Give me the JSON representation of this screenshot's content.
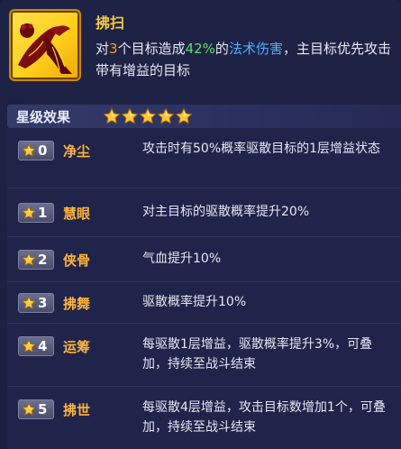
{
  "skill": {
    "name": "拂扫",
    "desc_parts": {
      "p1": "对",
      "targets": "3",
      "p2": "个目标造成",
      "percent": "42%",
      "p3": "的",
      "dmg_type": "法术伤害",
      "p4": "，主目标优先攻击带有增益的目标"
    }
  },
  "star_section": {
    "title": "星级效果",
    "star_count": 5
  },
  "rows": [
    {
      "level": "0",
      "name": "净尘",
      "text": "攻击时有50%概率驱散目标的1层增益状态"
    },
    {
      "level": "1",
      "name": "慧眼",
      "text": "对主目标的驱散概率提升20%"
    },
    {
      "level": "2",
      "name": "侠骨",
      "text": "气血提升10%"
    },
    {
      "level": "3",
      "name": "拂舞",
      "text": "驱散概率提升10%"
    },
    {
      "level": "4",
      "name": "运筹",
      "text": "每驱散1层增益，驱散概率提升3%，可叠加，持续至战斗结束"
    },
    {
      "level": "5",
      "name": "拂世",
      "text": "每驱散4层增益，攻击目标数增加1个，可叠加，持续至战斗结束"
    }
  ],
  "colors": {
    "accent_gold": "#f1c84a",
    "name_orange": "#ffb43a",
    "green": "#5be06a",
    "blue": "#4db2ff"
  },
  "icons": {
    "skill": "whisk-sweep-icon",
    "star": "gold-star-icon"
  }
}
